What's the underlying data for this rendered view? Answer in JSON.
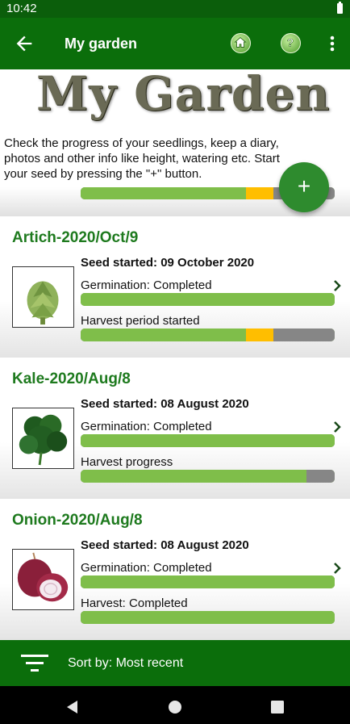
{
  "status": {
    "time": "10:42"
  },
  "appbar": {
    "title": "My garden"
  },
  "header": {
    "logo_text": "My Garden",
    "intro": "Check the progress of your seedlings, keep a diary, photos and other info like height, watering etc. Start your seed by pressing the \"+\" button.",
    "fab_label": "+"
  },
  "peek_progress": {
    "green": 0.65,
    "yellow": 0.11
  },
  "cards": [
    {
      "name": "Artich-2020/Oct/9",
      "started": "Seed started: 09 October 2020",
      "line1": "Germination: Completed",
      "line2": "Harvest period started",
      "bar1": {
        "green": 1.0
      },
      "bar2": {
        "green": 0.65,
        "yellow": 0.11
      }
    },
    {
      "name": "Kale-2020/Aug/8",
      "started": "Seed started: 08 August 2020",
      "line1": "Germination: Completed",
      "line2": "Harvest progress",
      "bar1": {
        "green": 1.0
      },
      "bar2": {
        "green": 0.89,
        "yellow": 0
      }
    },
    {
      "name": "Onion-2020/Aug/8",
      "started": "Seed started: 08 August 2020",
      "line1": "Germination: Completed",
      "line2": "Harvest: Completed",
      "bar1": {
        "green": 1.0
      },
      "bar2": {
        "green": 1.0,
        "yellow": 0
      }
    }
  ],
  "sort": {
    "label": "Sort by: Most recent"
  },
  "colors": {
    "primary": "#0b6e0b",
    "accent": "#2e8b2e",
    "bar_green": "#7fbe4a",
    "bar_yellow": "#ffbe00",
    "bar_gray": "#868686"
  },
  "icons": [
    "back-arrow-icon",
    "home-icon",
    "help-icon",
    "more-vert-icon",
    "plus-icon",
    "chevron-right-icon",
    "filter-icon",
    "nav-back-icon",
    "nav-home-icon",
    "nav-recents-icon"
  ]
}
